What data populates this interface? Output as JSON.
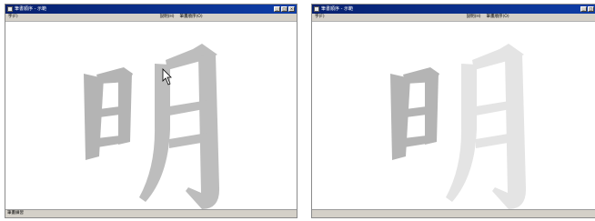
{
  "windows": [
    {
      "title": "筆書順序 - 示範",
      "menu": {
        "main": "字(F)",
        "faint": [
          "",
          "",
          "",
          "",
          ""
        ],
        "help": "說明(H)",
        "order": "筆畫順序(O)"
      },
      "character": "明",
      "status": "筆畫練習",
      "colors": {
        "ri": "#b4b4b4",
        "yue": "#bdbdbd"
      }
    },
    {
      "title": "筆書順序 - 示範",
      "menu": {
        "main": "字(F)",
        "faint": [
          "",
          "",
          "",
          "",
          ""
        ],
        "help": "說明(H)",
        "order": "筆畫順序(O)"
      },
      "character": "明",
      "status": "",
      "colors": {
        "ri": "#b4b4b4",
        "yue": "#e4e4e4"
      }
    }
  ],
  "window_buttons": [
    "_",
    "□",
    "×"
  ]
}
